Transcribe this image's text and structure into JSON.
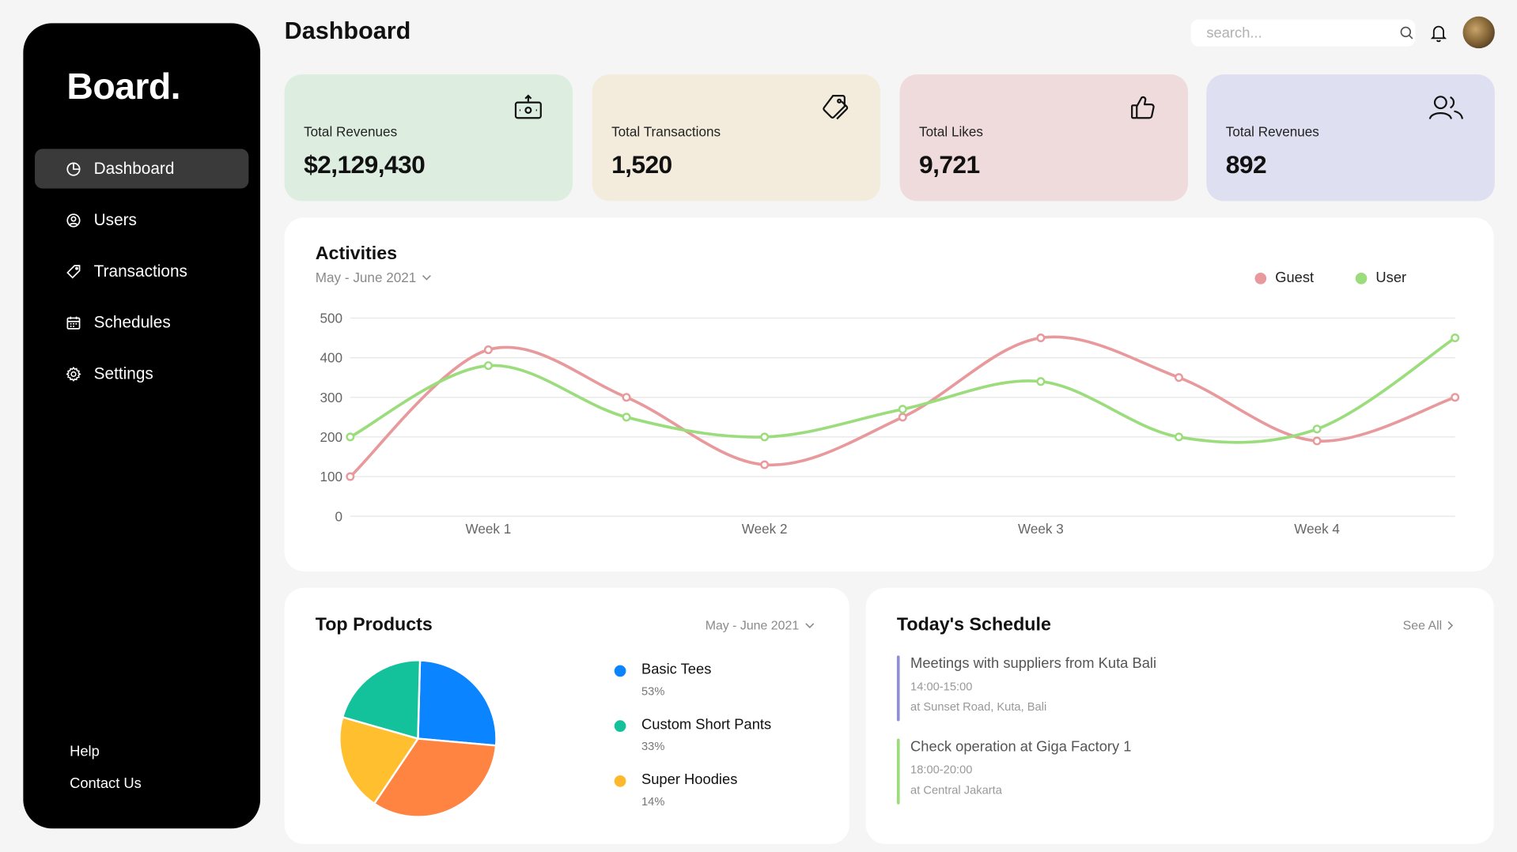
{
  "app": {
    "brand": "Board.",
    "page_title": "Dashboard"
  },
  "sidebar": {
    "items": [
      {
        "label": "Dashboard",
        "icon": "pie-icon",
        "active": true
      },
      {
        "label": "Users",
        "icon": "user-circle-icon"
      },
      {
        "label": "Transactions",
        "icon": "tag-icon"
      },
      {
        "label": "Schedules",
        "icon": "calendar-icon"
      },
      {
        "label": "Settings",
        "icon": "gear-icon"
      }
    ],
    "footer": {
      "help": "Help",
      "contact": "Contact Us"
    }
  },
  "header": {
    "search_placeholder": "search..."
  },
  "cards": [
    {
      "label": "Total Revenues",
      "value": "$2,129,430",
      "bg": "#ddeee0",
      "icon": "money-icon"
    },
    {
      "label": "Total Transactions",
      "value": "1,520",
      "bg": "#f3ecdd",
      "icon": "tag-icon"
    },
    {
      "label": "Total Likes",
      "value": "9,721",
      "bg": "#efdbdb",
      "icon": "thumbs-up-icon"
    },
    {
      "label": "Total Revenues",
      "value": "892",
      "bg": "#dedff0",
      "icon": "users-icon"
    }
  ],
  "activities": {
    "title": "Activities",
    "range": "May - June 2021",
    "legend": [
      {
        "name": "Guest",
        "color": "#e8999c"
      },
      {
        "name": "User",
        "color": "#9bdc7c"
      }
    ]
  },
  "chart_data": {
    "type": "line",
    "x": [
      0,
      1,
      2,
      3,
      4,
      5,
      6,
      7,
      8
    ],
    "x_tick_labels": [
      "Week 1",
      "Week 2",
      "Week 3",
      "Week 4"
    ],
    "x_tick_positions": [
      1,
      3,
      5,
      7
    ],
    "yticks": [
      "0",
      "100",
      "200",
      "300",
      "400",
      "500"
    ],
    "ylim": [
      0,
      500
    ],
    "grid": true,
    "legend_placement": "top-right",
    "series": [
      {
        "name": "Guest",
        "color": "#e8999c",
        "values": [
          100,
          420,
          300,
          130,
          250,
          450,
          350,
          190,
          300
        ]
      },
      {
        "name": "User",
        "color": "#9bdc7c",
        "values": [
          200,
          380,
          250,
          200,
          270,
          340,
          200,
          220,
          450
        ]
      }
    ]
  },
  "top_products": {
    "title": "Top Products",
    "range": "May - June 2021",
    "items": [
      {
        "name": "Basic Tees",
        "pct": "53%",
        "color": "#0a84ff"
      },
      {
        "name": "Custom Short Pants",
        "pct": "33%",
        "color": "#13c29b"
      },
      {
        "name": "Super Hoodies",
        "pct": "14%",
        "color": "#ffb82b"
      }
    ],
    "pie": [
      {
        "label": "blue",
        "value": 26,
        "color": "#0a84ff"
      },
      {
        "label": "orange",
        "value": 33,
        "color": "#ff8441"
      },
      {
        "label": "yellow",
        "value": 20,
        "color": "#ffbf2e"
      },
      {
        "label": "teal",
        "value": 21,
        "color": "#13c29b"
      }
    ]
  },
  "schedule": {
    "title": "Today's Schedule",
    "see_all": "See All",
    "events": [
      {
        "title": "Meetings with suppliers from Kuta Bali",
        "time": "14:00-15:00",
        "location": "at Sunset Road, Kuta, Bali",
        "color": "#8f8fd6"
      },
      {
        "title": "Check operation at Giga Factory 1",
        "time": "18:00-20:00",
        "location": "at Central Jakarta",
        "color": "#9bdc7c"
      }
    ]
  }
}
